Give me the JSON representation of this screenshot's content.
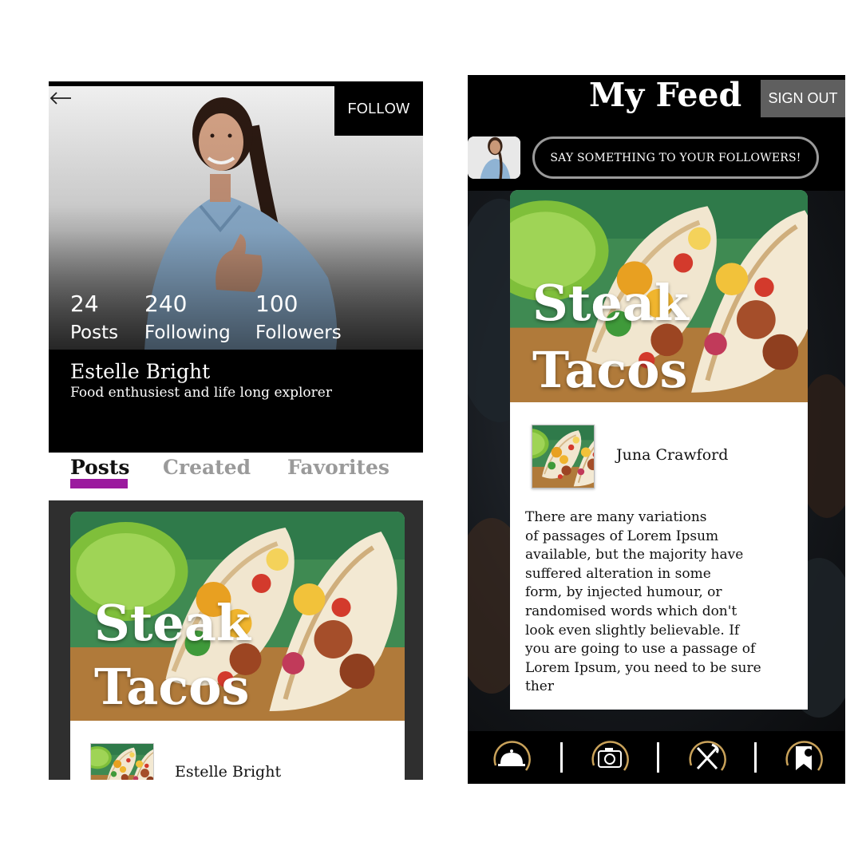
{
  "profile": {
    "follow_label": "FOLLOW",
    "stats": [
      {
        "value": "24",
        "label": "Posts"
      },
      {
        "value": "240",
        "label": "Following"
      },
      {
        "value": "100",
        "label": "Followers"
      }
    ],
    "name": "Estelle Bright",
    "bio": "Food enthusiest and life long explorer",
    "tabs": [
      {
        "label": "Posts",
        "active": true
      },
      {
        "label": "Created",
        "active": false
      },
      {
        "label": "Favorites",
        "active": false
      }
    ],
    "post": {
      "title_line1": "Steak",
      "title_line2": "Tacos",
      "author": "Estelle Bright"
    }
  },
  "feed": {
    "title": "My Feed",
    "signout_label": "SIGN OUT",
    "compose_placeholder": "SAY SOMETHING TO YOUR FOLLOWERS!",
    "post": {
      "title_line1": "Steak",
      "title_line2": "Tacos",
      "author": "Juna Crawford",
      "body_lines": [
        "There are many variations",
        "of passages of Lorem Ipsum",
        "available, but the majority have",
        "suffered alteration in some",
        "form, by injected humour, or",
        "randomised words which don't",
        "look even slightly believable. If",
        "you are going to use a passage of",
        "Lorem Ipsum, you need to be sure",
        "ther"
      ]
    },
    "nav": [
      {
        "icon": "cloche-icon"
      },
      {
        "icon": "camera-icon"
      },
      {
        "icon": "fork-knife-icon"
      },
      {
        "icon": "bookmark-icon"
      }
    ]
  },
  "colors": {
    "tab_accent": "#9b1a9e",
    "nav_ring": "#c9a25a",
    "signout_bg": "#5f5f5f"
  }
}
